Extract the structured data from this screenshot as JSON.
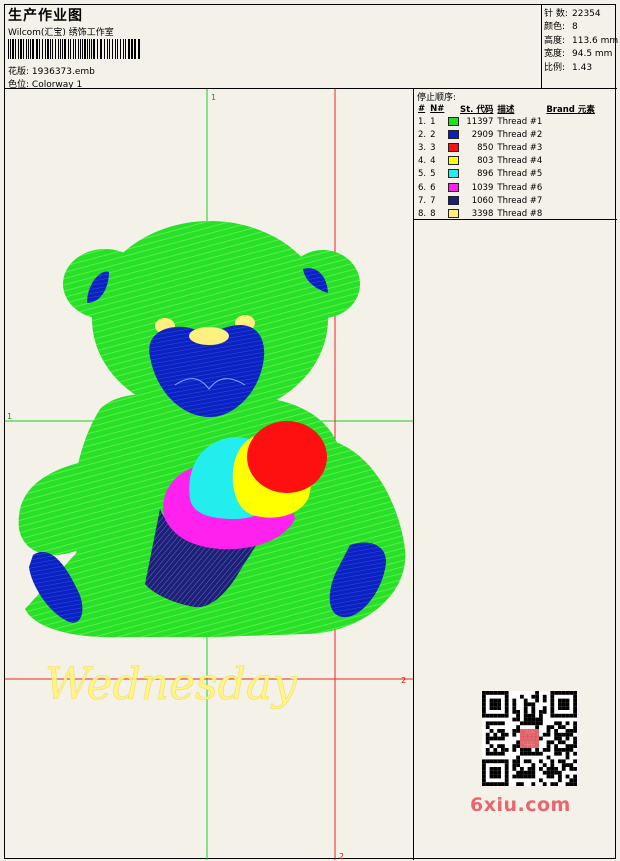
{
  "header": {
    "title": "生产作业图",
    "company": "Wilcom(汇宝) 绣饰工作室",
    "file_label": "花版:",
    "file_value": "1936373.emb",
    "colorway_label": "色位:",
    "colorway_value": "Colorway 1"
  },
  "stats": {
    "stitches_label": "针 数:",
    "stitches_value": "22354",
    "colors_label": "颜色:",
    "colors_value": "8",
    "height_label": "高度:",
    "height_value": "113.6 mm",
    "width_label": "宽度:",
    "width_value": "94.5 mm",
    "ratio_label": "比例:",
    "ratio_value": "1.43"
  },
  "threads": {
    "title": "停止顺序:",
    "columns": [
      "#",
      "N#",
      "St.",
      "代码",
      "描述",
      "Brand",
      "元素"
    ],
    "rows": [
      {
        "i": "1.",
        "n": "1",
        "color": "#22dd22",
        "st": "11397",
        "desc": "Thread #1"
      },
      {
        "i": "2.",
        "n": "2",
        "color": "#0a1fbf",
        "st": "2909",
        "desc": "Thread #2"
      },
      {
        "i": "3.",
        "n": "3",
        "color": "#ff1010",
        "st": "850",
        "desc": "Thread #3"
      },
      {
        "i": "4.",
        "n": "4",
        "color": "#ffff00",
        "st": "803",
        "desc": "Thread #4"
      },
      {
        "i": "5.",
        "n": "5",
        "color": "#22eeee",
        "st": "896",
        "desc": "Thread #5"
      },
      {
        "i": "6.",
        "n": "6",
        "color": "#ff22ee",
        "st": "1039",
        "desc": "Thread #6"
      },
      {
        "i": "7.",
        "n": "7",
        "color": "#1a1f7a",
        "st": "1060",
        "desc": "Thread #7"
      },
      {
        "i": "8.",
        "n": "8",
        "color": "#fff080",
        "st": "3398",
        "desc": "Thread #8"
      }
    ]
  },
  "design": {
    "guide_label_top": "1",
    "guide_label_left": "1",
    "guide_label_right": "2",
    "guide_label_bottom": "2",
    "lettering": "Wednesday"
  },
  "watermark": "6xiu.com"
}
